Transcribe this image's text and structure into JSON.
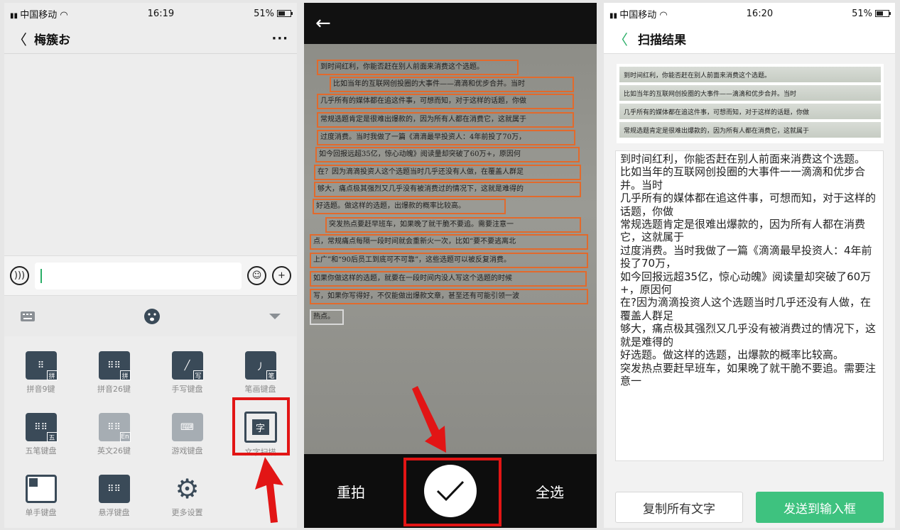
{
  "left": {
    "status": {
      "carrier": "中国移动",
      "time": "16:19",
      "battery": "51%"
    },
    "chat": {
      "title": "梅簇お",
      "more": "···"
    },
    "keyboards": [
      {
        "label": "拼音9键",
        "sub": "拼"
      },
      {
        "label": "拼音26键",
        "sub": "拼"
      },
      {
        "label": "手写键盘",
        "sub": "写"
      },
      {
        "label": "笔画键盘",
        "sub": "笔"
      },
      {
        "label": "五笔键盘",
        "sub": "五"
      },
      {
        "label": "英文26键",
        "sub": "En"
      },
      {
        "label": "游戏键盘",
        "sub": ""
      },
      {
        "label": "文字扫描",
        "sub": "字"
      },
      {
        "label": "单手键盘",
        "sub": ""
      },
      {
        "label": "悬浮键盘",
        "sub": ""
      },
      {
        "label": "更多设置",
        "sub": ""
      }
    ]
  },
  "middle": {
    "lines": [
      "到时间红利，你能否赶在别人前面来消费这个选题。",
      "比如当年的互联网创投圈的大事件——滴滴和优步合并。当时",
      "几乎所有的媒体都在追这件事，可想而知，对于这样的话题，你做",
      "常规选题肯定是很难出爆款的，因为所有人都在消费它，这就属于",
      "过度消费。当时我做了一篇《滴滴最早投资人：4年前投了70万，",
      "如今回报远超35亿，惊心动魄》阅读量却突破了60万+，原因何",
      "在？因为滴滴投资人这个选题当时几乎还没有人做，在覆盖人群足",
      "够大，痛点极其强烈又几乎没有被消费过的情况下，这就是难得的",
      "好选题。做这样的选题，出爆款的概率比较高。",
      "突发热点要赶早班车，如果晚了就干脆不要追。需要注意一",
      "点，常规痛点每隔一段时间就会重新火一次，比如“要不要逃离北",
      "上广”和“90后员工到底可不可靠”，这些选题可以被反复消费。",
      "如果你做这样的选题，就要在一段时间内没人写这个选题的时候",
      "写，如果你写得好，不仅能做出爆款文章，甚至还有可能引领一波",
      "热点。"
    ],
    "retake": "重拍",
    "select_all": "全选"
  },
  "right": {
    "status": {
      "carrier": "中国移动",
      "time": "16:20",
      "battery": "51%"
    },
    "title": "扫描结果",
    "thumb_lines": [
      "到时间红利，你能否赶在别人前面来消费这个选题。",
      "比如当年的互联网创投圈的大事件——滴滴和优步合并。当时",
      "几乎所有的媒体都在追这件事，可想而知，对于这样的话题，你做",
      "常规选题肯定是很难出爆款的，因为所有人都在消费它，这就属于"
    ],
    "result_lines": [
      "到时间红利，你能否赶在别人前面来消费这个选题。",
      "比如当年的互联网创投圈的大事件一一滴滴和优步合并。当时",
      "几乎所有的媒体都在追这件事，可想而知，对于这样的话题，你做",
      "常规选题肯定是很难出爆款的，因为所有人都在消费它，这就属于",
      "过度消费。当时我做了一篇《滴滴最早投资人：4年前投了70万，",
      "如今回报远超35亿，惊心动魄》阅读量却突破了60万+，原因何",
      "在?因为滴滴投资人这个选题当时几乎还没有人做，在覆盖人群足",
      "够大，痛点极其强烈又几乎没有被消费过的情况下，这就是难得的",
      "好选题。做这样的选题，出爆款的概率比较高。",
      "突发热点要赶早班车，如果晚了就干脆不要追。需要注意一"
    ],
    "copy_all": "复制所有文字",
    "send_to_input": "发送到输入框"
  }
}
